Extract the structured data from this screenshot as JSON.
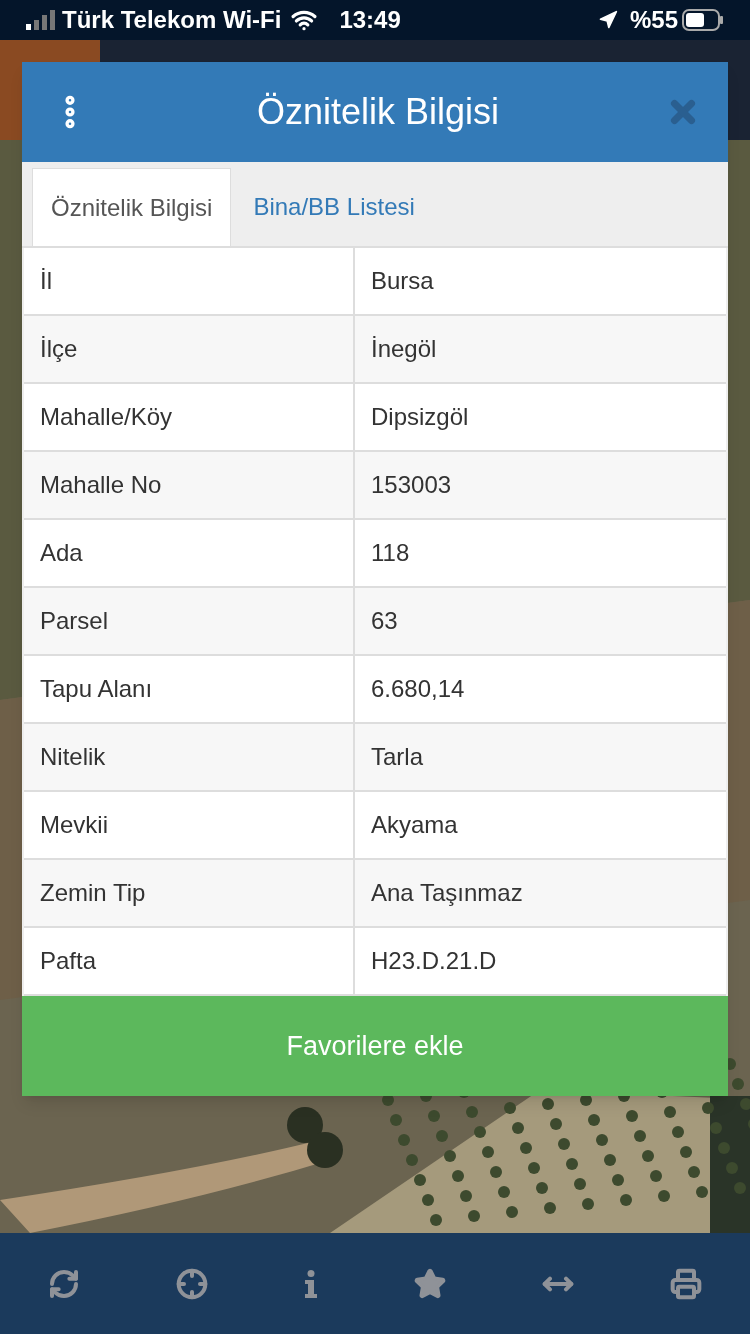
{
  "status_bar": {
    "carrier": "Türk Telekom Wi-Fi",
    "time": "13:49",
    "battery": "%55"
  },
  "dialog": {
    "title": "Öznitelik Bilgisi",
    "tabs": [
      {
        "label": "Öznitelik Bilgisi",
        "selected": true
      },
      {
        "label": "Bina/BB Listesi",
        "selected": false
      }
    ],
    "rows": [
      {
        "label": "İl",
        "value": "Bursa"
      },
      {
        "label": "İlçe",
        "value": "İnegöl"
      },
      {
        "label": "Mahalle/Köy",
        "value": "Dipsizgöl"
      },
      {
        "label": "Mahalle No",
        "value": "153003"
      },
      {
        "label": "Ada",
        "value": "118"
      },
      {
        "label": "Parsel",
        "value": "63"
      },
      {
        "label": "Tapu Alanı",
        "value": "6.680,14"
      },
      {
        "label": "Nitelik",
        "value": "Tarla"
      },
      {
        "label": "Mevkii",
        "value": "Akyama"
      },
      {
        "label": "Zemin Tip",
        "value": "Ana Taşınmaz"
      },
      {
        "label": "Pafta",
        "value": "H23.D.21.D"
      }
    ],
    "button": "Favorilere ekle"
  }
}
